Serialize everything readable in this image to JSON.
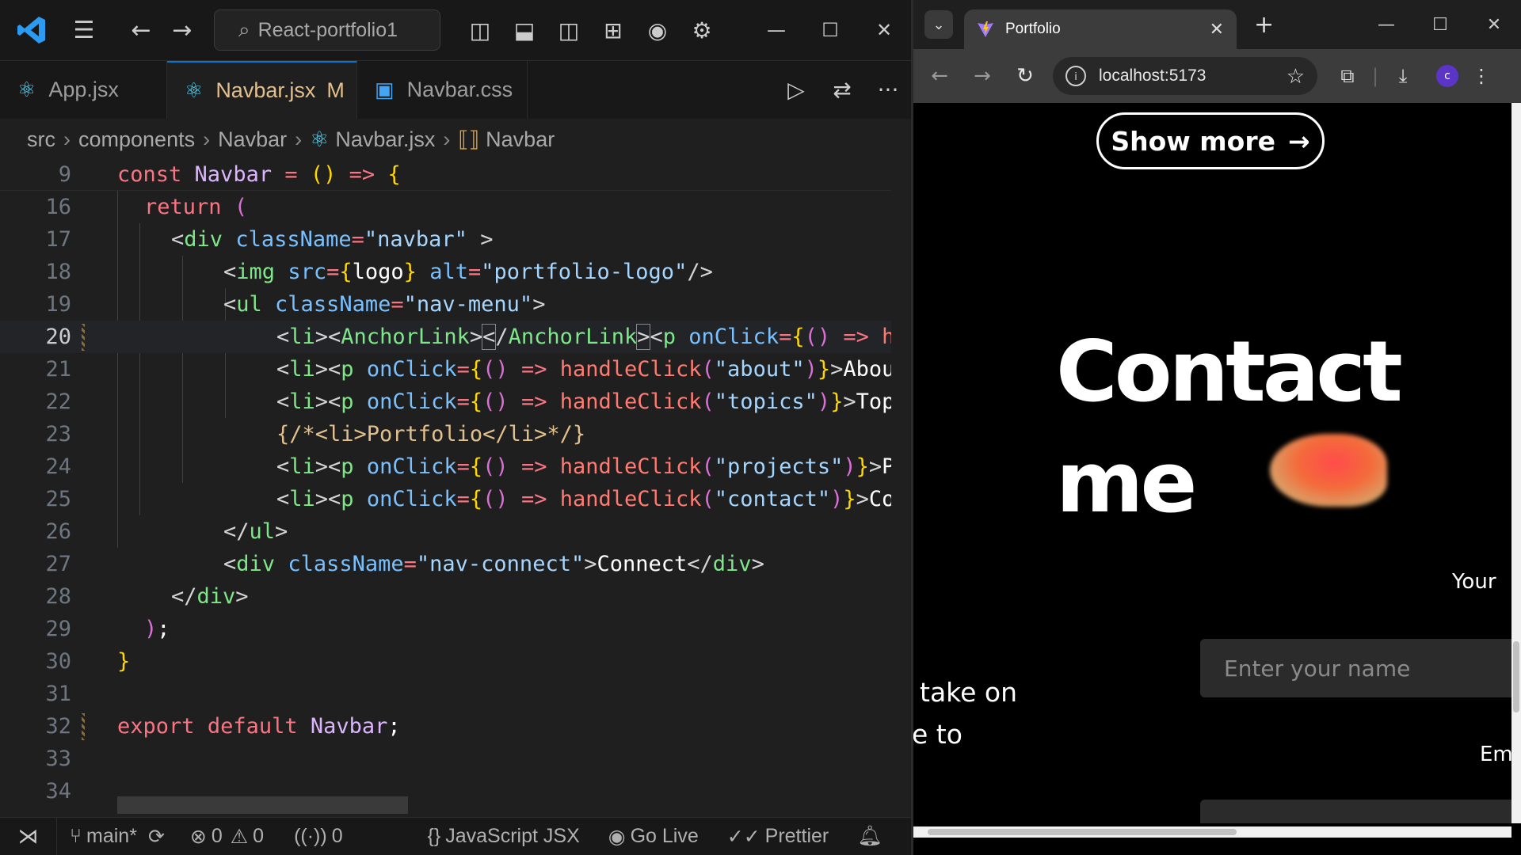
{
  "vscode": {
    "search_label": "React-portfolio1",
    "tabs": [
      {
        "label": "App.jsx",
        "icon": "react-icon"
      },
      {
        "label": "Navbar.jsx",
        "modified": "M",
        "icon": "react-icon"
      },
      {
        "label": "Navbar.css",
        "icon": "css3-icon"
      }
    ],
    "breadcrumb": [
      "src",
      "components",
      "Navbar",
      "Navbar.jsx",
      "Navbar"
    ],
    "lines": [
      {
        "n": "9",
        "text": "const Navbar = () => {"
      },
      {
        "n": "16",
        "text": "return ("
      },
      {
        "n": "17",
        "text": "<div className=\"navbar\" >"
      },
      {
        "n": "18",
        "text": "<img src={logo} alt=\"portfolio-logo\"/>"
      },
      {
        "n": "19",
        "text": "<ul className=\"nav-menu\">"
      },
      {
        "n": "20",
        "text": "<li><AnchorLink></AnchorLink><p onClick={() => ha"
      },
      {
        "n": "21",
        "text": "<li><p onClick={() => handleClick(\"about\")}>Abou"
      },
      {
        "n": "22",
        "text": "<li><p onClick={() => handleClick(\"topics\")}>Topi"
      },
      {
        "n": "23",
        "text": "{/*<li>Portfolio</li>*/}"
      },
      {
        "n": "24",
        "text": "<li><p onClick={() => handleClick(\"projects\")}>Pr"
      },
      {
        "n": "25",
        "text": "<li><p onClick={() => handleClick(\"contact\")}>Con"
      },
      {
        "n": "26",
        "text": "</ul>"
      },
      {
        "n": "27",
        "text": "<div className=\"nav-connect\">Connect</div>"
      },
      {
        "n": "28",
        "text": "</div>"
      },
      {
        "n": "29",
        "text": ");"
      },
      {
        "n": "30",
        "text": "}"
      },
      {
        "n": "31",
        "text": ""
      },
      {
        "n": "32",
        "text": "export default Navbar;"
      },
      {
        "n": "33",
        "text": ""
      },
      {
        "n": "34",
        "text": ""
      }
    ],
    "status": {
      "branch": "main*",
      "errors": "0",
      "warnings": "0",
      "ports": "0",
      "language": "JavaScript JSX",
      "go_live": "Go Live",
      "prettier": "Prettier"
    }
  },
  "browser": {
    "tab_title": "Portfolio",
    "url": "localhost:5173",
    "avatar_letter": "c",
    "page": {
      "show_more": "Show more",
      "contact_line1": "Contact",
      "contact_line2": "me",
      "your_name_label": "Your",
      "name_placeholder": "Enter your name",
      "side_text1": "take on",
      "side_text2": "e to",
      "email_label": "Em"
    }
  },
  "colors": {
    "vscode_accent": "#0078d4",
    "modified_tab": "#e2c08d",
    "avatar": "#5b34c8"
  }
}
